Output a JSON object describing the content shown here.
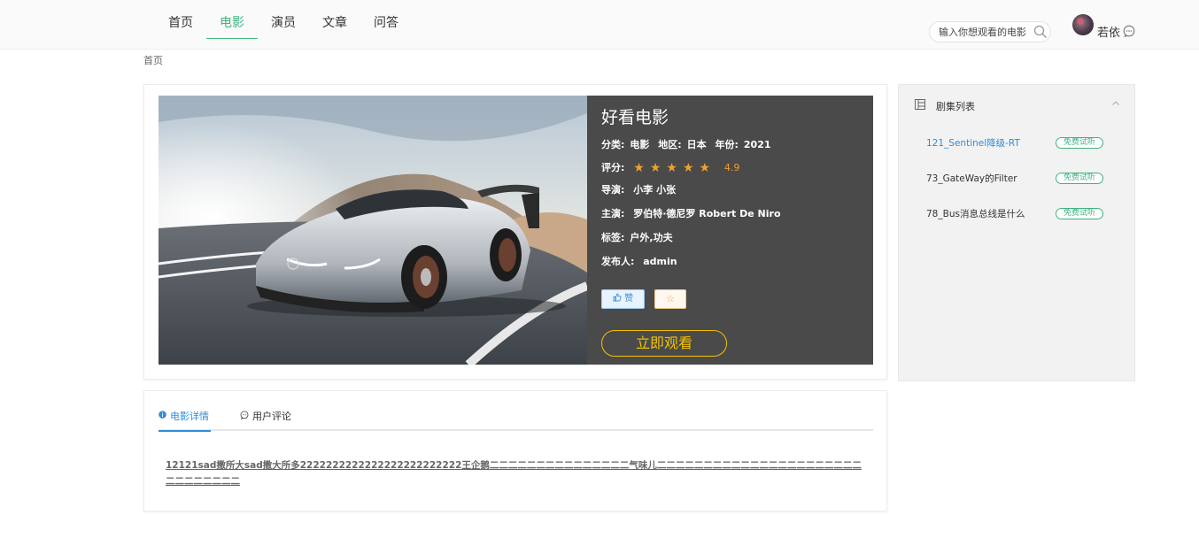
{
  "nav": {
    "items": [
      {
        "label": "首页",
        "active": false
      },
      {
        "label": "电影",
        "active": true
      },
      {
        "label": "演员",
        "active": false
      },
      {
        "label": "文章",
        "active": false
      },
      {
        "label": "问答",
        "active": false
      }
    ]
  },
  "search": {
    "placeholder": "输入你想观看的电影"
  },
  "user": {
    "name": "若依"
  },
  "breadcrumb": "首页",
  "movie": {
    "title": "好看电影",
    "category_label": "分类:",
    "category": "电影",
    "region_label": "地区:",
    "region": "日本",
    "year_label": "年份:",
    "year": "2021",
    "rating_label": "评分:",
    "rating": "4.9",
    "stars": 5,
    "director_label": "导演:",
    "director": "小李 小张",
    "cast_label": "主演:",
    "cast": "罗伯特·德尼罗 Robert De Niro",
    "tags_label": "标签:",
    "tags": "户外,功夫",
    "publisher_label": "发布人:",
    "publisher": "admin",
    "like_label": "赞",
    "fav_label": "☆",
    "watch_label": "立即观看"
  },
  "detail": {
    "tabs": [
      {
        "label": "电影详情",
        "active": true
      },
      {
        "label": "用户评论",
        "active": false
      }
    ],
    "description": "12121sad撒所大sad撒大所多2222222222222222222222222王企鹅二二二二二二二二二二二二二二二气味儿二二二二二二二二二二二二二二二二二二二二二二二二二二二二二二"
  },
  "episodes": {
    "title": "剧集列表",
    "items": [
      {
        "name": "121_Sentinel降级-RT",
        "badge": "免费试听",
        "active": true
      },
      {
        "name": "73_GateWay的Filter",
        "badge": "免费试听",
        "active": false
      },
      {
        "name": "78_Bus消息总线是什么",
        "badge": "免费试听",
        "active": false
      }
    ]
  },
  "colors": {
    "accent_green": "#3fb380",
    "accent_blue": "#2f8dd8",
    "gold": "#f2c200",
    "star": "#f0a030",
    "info_bg": "#4a4a4a"
  }
}
